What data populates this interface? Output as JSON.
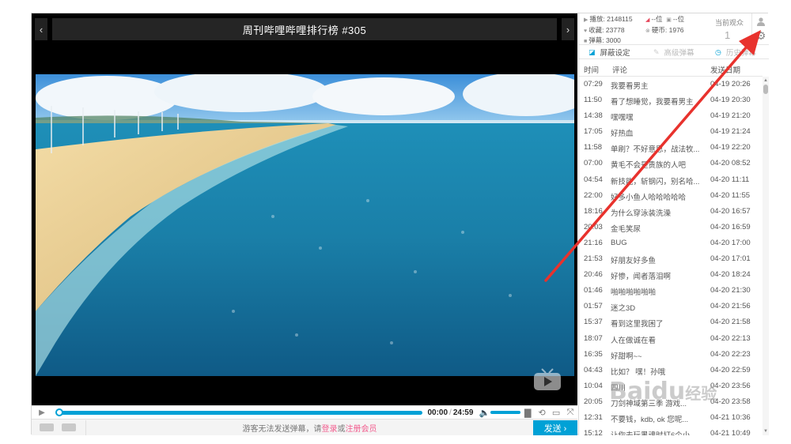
{
  "player": {
    "title": "周刊哔哩哔哩排行榜 #305",
    "prev_glyph": "‹",
    "next_glyph": "›",
    "current_time": "00:00",
    "duration": "24:59",
    "progress": 0.0
  },
  "danmaku_input": {
    "prefix": "游客无法发送弹幕，请",
    "login": "登录",
    "or": "或",
    "register": "注册会员",
    "send_label": "发送 ›"
  },
  "stats": {
    "plays_label": "播放:",
    "plays": "2148115",
    "favs_label": "收藏:",
    "favs": "23778",
    "danmaku_label": "弹幕:",
    "danmaku": "3000",
    "rank_a": "--位",
    "rank_b": "--位",
    "coins_label": "硬币:",
    "coins": "1976",
    "viewers_label": "当前观众",
    "viewers": "1"
  },
  "tabs": {
    "block": "屏蔽设定",
    "advanced": "高级弹幕",
    "history": "历史弹幕"
  },
  "list_header": {
    "time": "时间",
    "comment": "评论",
    "date": "发送日期"
  },
  "danmaku_rows": [
    {
      "time": "07:29",
      "text": "我要看男主",
      "date": "04-19 20:26"
    },
    {
      "time": "11:50",
      "text": "看了想睡觉，我要看男主",
      "date": "04-19 20:30"
    },
    {
      "time": "14:38",
      "text": "嘿嘿嘿",
      "date": "04-19 21:20"
    },
    {
      "time": "17:05",
      "text": "好热血",
      "date": "04-19 21:24"
    },
    {
      "time": "11:58",
      "text": "单刷？不好意思，战法牧...",
      "date": "04-19 22:20"
    },
    {
      "time": "07:00",
      "text": "黄毛不会是贵族的人吧",
      "date": "04-20 08:52"
    },
    {
      "time": "04:54",
      "text": "新技能，斩钢闪，别名哈...",
      "date": "04-20 11:11"
    },
    {
      "time": "22:00",
      "text": "好多小鱼人哈哈哈哈哈",
      "date": "04-20 11:55"
    },
    {
      "time": "18:16",
      "text": "为什么穿泳装洗澡",
      "date": "04-20 16:57"
    },
    {
      "time": "20:03",
      "text": "金毛笑尿",
      "date": "04-20 16:59"
    },
    {
      "time": "21:16",
      "text": "BUG",
      "date": "04-20 17:00"
    },
    {
      "time": "21:53",
      "text": "好朋友好多鱼",
      "date": "04-20 17:01"
    },
    {
      "time": "20:46",
      "text": "好惨，闻者落泪啊",
      "date": "04-20 18:24"
    },
    {
      "time": "01:46",
      "text": "啪啪啪啪啪啪",
      "date": "04-20 21:30"
    },
    {
      "time": "01:57",
      "text": "迷之3D",
      "date": "04-20 21:56"
    },
    {
      "time": "15:37",
      "text": "看到这里我困了",
      "date": "04-20 21:58"
    },
    {
      "time": "18:07",
      "text": "人在做诚在看",
      "date": "04-20 22:13"
    },
    {
      "time": "16:35",
      "text": "好甜啊~~",
      "date": "04-20 22:23"
    },
    {
      "time": "04:43",
      "text": "比如？ 嘿！孙哦",
      "date": "04-20 22:59"
    },
    {
      "time": "10:04",
      "text": "四川",
      "date": "04-20 23:56"
    },
    {
      "time": "20:05",
      "text": "刀剑神域第三季 游戏...",
      "date": "04-20 23:58"
    },
    {
      "time": "12:31",
      "text": "不要钱，kdb, ok 您呢...",
      "date": "04-21 10:36"
    },
    {
      "time": "15:12",
      "text": "让你去玩黑魂时打6个小...",
      "date": "04-21 10:49"
    }
  ],
  "watermark": {
    "main": "Baidu",
    "sub": "经验"
  },
  "colors": {
    "accent": "#00a1d6",
    "pink": "#f25d8e",
    "annotation": "#e8322d"
  }
}
